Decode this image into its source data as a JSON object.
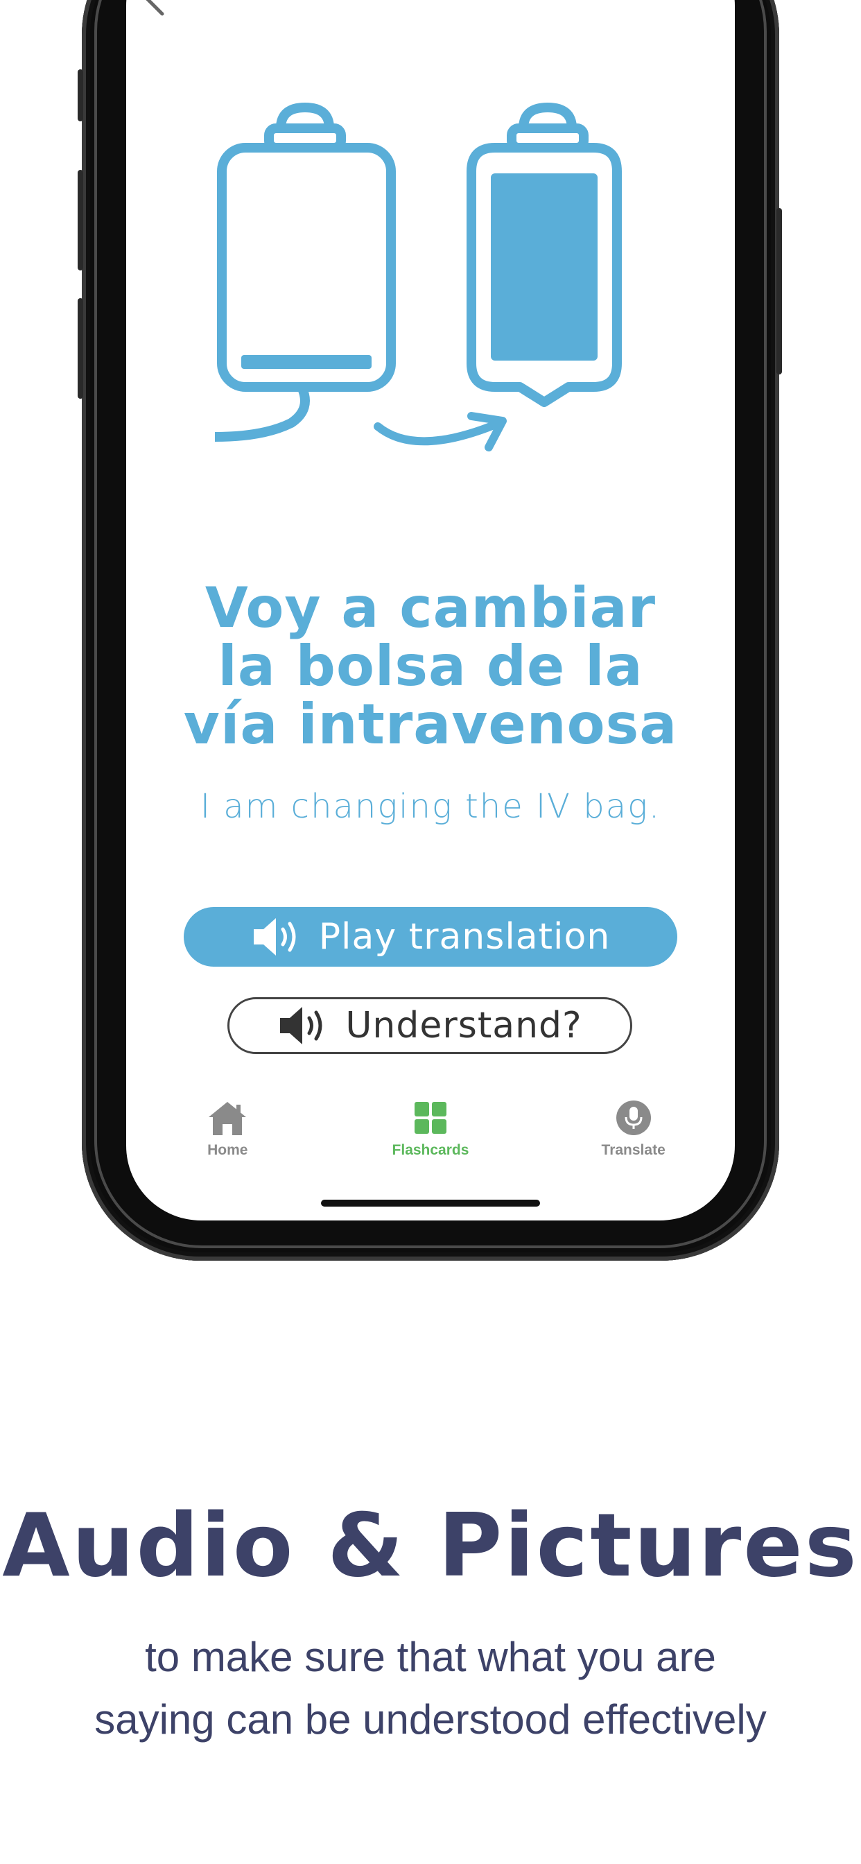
{
  "card": {
    "phrase_lines": [
      "Voy a cambiar",
      "la bolsa de la",
      "vía intravenosa"
    ],
    "translation": "I am changing the IV bag.",
    "play_label": "Play translation",
    "understand_label": "Understand?",
    "illustration": "iv-bag-empty-to-full-illustration"
  },
  "tabs": [
    {
      "label": "Home",
      "icon": "house-icon",
      "active": false
    },
    {
      "label": "Flashcards",
      "icon": "grid-icon",
      "active": true
    },
    {
      "label": "Translate",
      "icon": "microphone-icon",
      "active": false
    }
  ],
  "promo": {
    "headline": "Audio & Pictures",
    "sub_lines": [
      "to make sure that what you are",
      "saying can be understood effectively"
    ]
  },
  "colors": {
    "accent": "#5aaed8",
    "active_tab": "#5cb85c",
    "inactive_tab": "#8a8a8a",
    "promo_text": "#3d4268"
  }
}
